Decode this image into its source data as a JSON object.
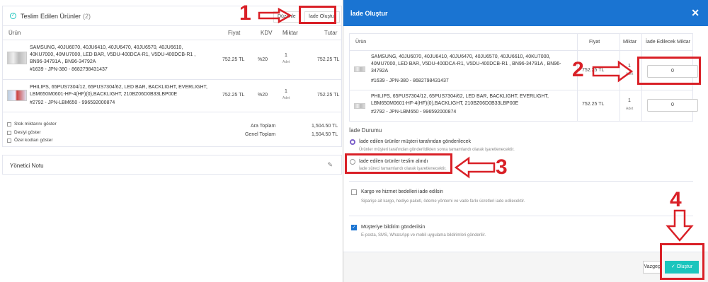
{
  "bg": {
    "title": "Teslim Edilen Ürünler",
    "count": "(2)",
    "edit_label": "Düzenle",
    "create_return_label": "İade Oluştur",
    "columns": [
      "Ürün",
      "Fiyat",
      "KDV",
      "Miktar",
      "Tutar"
    ],
    "rows": [
      {
        "name": "SAMSUNG, 40JU6070, 40JU6410, 40JU6470, 40JU6570, 40JU6610, 40KU7000, 40MU7000, LED BAR, V5DU-400DCA-R1, V5DU-400DCB-R1 , BN96-34791A , BN96-34792A",
        "sku": "#1639 - JPN-380 - 8682798431437",
        "price": "752.25 TL",
        "kdv": "%20",
        "qty": "1",
        "unit": "Adet",
        "total": "752.25 TL"
      },
      {
        "name": "PHILIPS, 65PUS7304/12, 65PUS7304/62, LED BAR, BACKLIGHT, EVERLIGHT, LBM650M0601-HF-4(HF)(0),BACKLIGHT, 210BZ06D0B33LBP00E",
        "sku": "#2792 - JPN-LBM650 - 996592000874",
        "price": "752.25 TL",
        "kdv": "%20",
        "qty": "1",
        "unit": "Adet",
        "total": "752.25 TL"
      }
    ],
    "checks": [
      "Stok miktarını göster",
      "Desiyi göster",
      "Özel kodları göster"
    ],
    "subtotal_label": "Ara Toplam",
    "subtotal_value": "1,504.50 TL",
    "grandtotal_label": "Genel Toplam",
    "grandtotal_value": "1,504.50 TL",
    "manager_note": "Yönetici Notu"
  },
  "modal": {
    "title": "İade Oluştur",
    "columns": [
      "Ürün",
      "Fiyat",
      "Miktar",
      "İade Edilecek Miktar"
    ],
    "rows": [
      {
        "name": "SAMSUNG, 40JU6070, 40JU6410, 40JU6470, 40JU6570, 40JU6610, 40KU7000, 40MU7000, LED BAR, V5DU-400DCA-R1, V5DU-400DCB-R1 , BN96-34791A , BN96-34792A",
        "sku": "#1639 - JPN-380 - 8682798431437",
        "price": "752.25 TL",
        "qty": "1",
        "unit": "Adet",
        "return_qty": "0"
      },
      {
        "name": "PHILIPS, 65PUS7304/12, 65PUS7304/62, LED BAR, BACKLIGHT, EVERLIGHT, LBM650M0601-HF-4(HF)(0),BACKLIGHT, 210BZ06D0B33LBP00E",
        "sku": "#2792 - JPN-LBM650 - 996592000874",
        "price": "752.25 TL",
        "qty": "1",
        "unit": "Adet",
        "return_qty": "0"
      }
    ],
    "status_label": "İade Durumu",
    "option1": "İade edilen ürünler müşteri tarafından gönderilecek",
    "option1_sub": "Ürünler müşteri tarafından gönderildikten sonra tamamlandı olarak işaretlenecektir.",
    "option2": "İade edilen ürünler teslim alındı",
    "option2_sub": "İade süreci tamamlandı olarak işaretlenecektir.",
    "cargo_label": "Kargo ve hizmet bedelleri iade edilsin",
    "cargo_sub": "Siparişe ait kargo, hediye paketi, ödeme yöntemi ve vade farkı ücretleri iade edilecektir.",
    "notify_label": "Müşteriye bildirim gönderilsin",
    "notify_sub": "E-posta, SMS, WhatsApp ve mobil uygulama bildirimleri gönderilir.",
    "cancel_label": "Vazgeç",
    "submit_label": "Oluştur"
  },
  "annotations": {
    "step1": "1",
    "step2": "2",
    "step3": "3",
    "step4": "4"
  },
  "colors": {
    "accent": "#1a74d2",
    "success": "#1bc5bd",
    "annotation": "#d92027"
  }
}
